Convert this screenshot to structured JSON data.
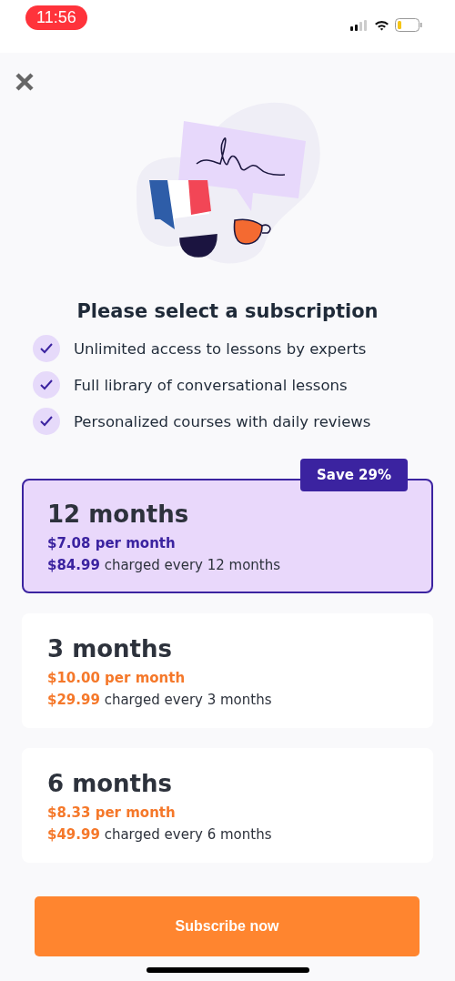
{
  "status_bar": {
    "time": "11:56"
  },
  "title": "Please select a subscription",
  "features": [
    {
      "text": "Unlimited access to lessons by experts",
      "checked": true
    },
    {
      "text": "Full library of conversational lessons",
      "checked": true
    },
    {
      "text": "Personalized courses with daily reviews",
      "checked": true
    }
  ],
  "plans": [
    {
      "name": "12 months",
      "monthly": "$7.08 per month",
      "billing": "**$84.99** charged every 12 months",
      "badge": "Save 29%",
      "selected": true
    },
    {
      "name": "3 months",
      "monthly": "$10.00 per month",
      "billing": "**$29.99** charged every 3 months",
      "selected": false
    },
    {
      "name": "6 months",
      "monthly": "$8.33 per month",
      "billing": "**$49.99** charged every 6 months",
      "selected": false
    }
  ],
  "button": "Subscribe now"
}
